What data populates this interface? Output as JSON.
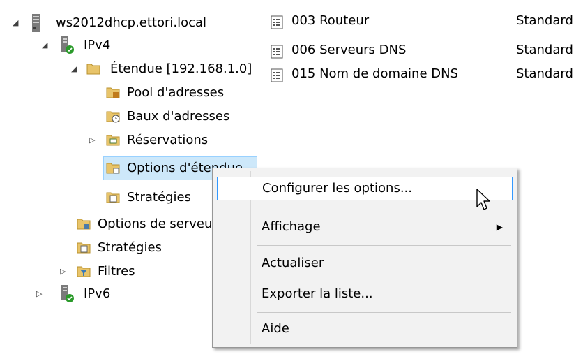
{
  "tree": {
    "server": "ws2012dhcp.ettori.local",
    "ipv4": "IPv4",
    "scope": "Étendue [192.168.1.0]",
    "pool": "Pool d'adresses",
    "leases": "Baux d'adresses",
    "reservations": "Réservations",
    "scope_options": "Options d'étendue",
    "scope_policies": "Stratégies",
    "server_options": "Options de serveur",
    "policies": "Stratégies",
    "filters": "Filtres",
    "ipv6": "IPv6"
  },
  "options": [
    {
      "name": "003 Routeur",
      "vendor": "Standard"
    },
    {
      "name": "006 Serveurs DNS",
      "vendor": "Standard"
    },
    {
      "name": "015 Nom de domaine DNS",
      "vendor": "Standard"
    }
  ],
  "context_menu": {
    "configure": "Configurer les options...",
    "view": "Affichage",
    "refresh": "Actualiser",
    "export": "Exporter la liste...",
    "help": "Aide"
  },
  "icons": {
    "server": "server-icon",
    "ipv4": "ipv4-icon",
    "folder": "folder-icon",
    "option": "option-icon",
    "filter": "filter-icon"
  },
  "colors": {
    "selection": "#cde8fa",
    "menu_highlight_border": "#3399ff"
  }
}
